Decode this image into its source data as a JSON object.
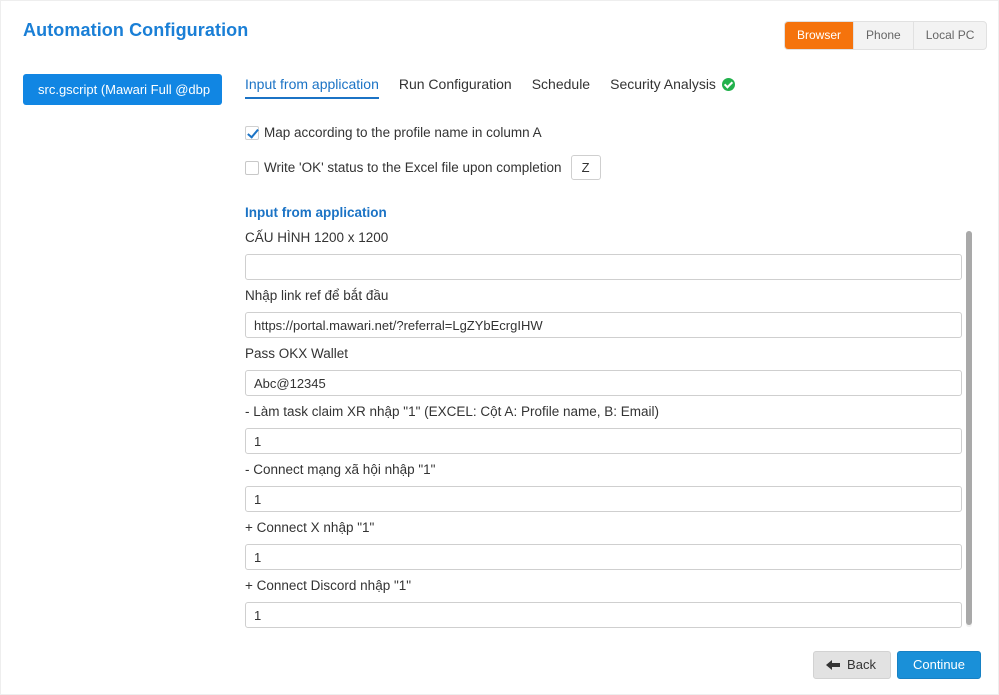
{
  "header": {
    "title": "Automation Configuration",
    "modes": [
      "Browser",
      "Phone",
      "Local PC"
    ],
    "active_mode": "Browser",
    "accent_color": "#f5730c"
  },
  "sidebar": {
    "script_item": "src.gscript   (Mawari Full @dbp"
  },
  "tabs": {
    "items": [
      "Input from application",
      "Run Configuration",
      "Schedule",
      "Security Analysis"
    ],
    "active": "Input from application",
    "security_status": "check-circle-icon green"
  },
  "options": {
    "map_profile": {
      "label": "Map according to the profile name in column A",
      "checked": true
    },
    "write_ok": {
      "label": "Write 'OK' status to the Excel file upon completion",
      "checked": false,
      "column": "Z"
    }
  },
  "section": {
    "title": "Input from application"
  },
  "fields": [
    {
      "label": "CẤU HÌNH 1200 x 1200",
      "value": ""
    },
    {
      "label": "Nhập link ref để bắt đầu",
      "value": "https://portal.mawari.net/?referral=LgZYbEcrgIHW"
    },
    {
      "label": "Pass OKX Wallet",
      "value": "Abc@12345"
    },
    {
      "label": "- Làm task claim XR nhập \"1\" (EXCEL: Cột A: Profile name, B: Email)",
      "value": "1"
    },
    {
      "label": "- Connect mạng xã hội nhập \"1\"",
      "value": "1"
    },
    {
      "label": "+ Connect X nhập \"1\"",
      "value": "1"
    },
    {
      "label": "+ Connect Discord nhập \"1\"",
      "value": "1"
    }
  ],
  "footer": {
    "back_label": "Back",
    "continue_label": "Continue",
    "primary_color": "#1a90d8"
  }
}
